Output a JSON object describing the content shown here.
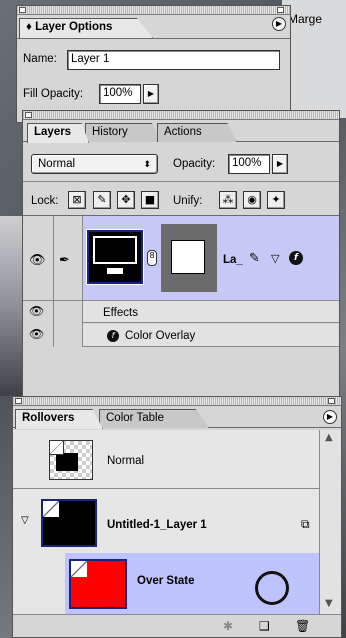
{
  "background": {
    "peek_text": "Marge"
  },
  "layer_options": {
    "title": "Layer Options",
    "title_glyph": "♦",
    "name_label": "Name:",
    "name_value": "Layer 1",
    "fill_opacity_label": "Fill Opacity:",
    "fill_opacity_value": "100%"
  },
  "layers_palette": {
    "tabs": [
      "Layers",
      "History",
      "Actions"
    ],
    "blend_mode": "Normal",
    "opacity_label": "Opacity:",
    "opacity_value": "100%",
    "lock_label": "Lock:",
    "unify_label": "Unify:",
    "layer": {
      "name": "La_",
      "has_style": true
    },
    "effects_label": "Effects",
    "effect_item": "Color Overlay"
  },
  "rollovers_palette": {
    "tabs": [
      "Rollovers",
      "Color Table"
    ],
    "items": [
      {
        "label": "Normal"
      },
      {
        "label": "Untitled-1_Layer 1"
      },
      {
        "label": "Over State"
      }
    ]
  },
  "colors": {
    "selection": "#c6c9f6",
    "over_state_swatch": "#ff0000",
    "palette_bg": "#d6d6d6"
  }
}
